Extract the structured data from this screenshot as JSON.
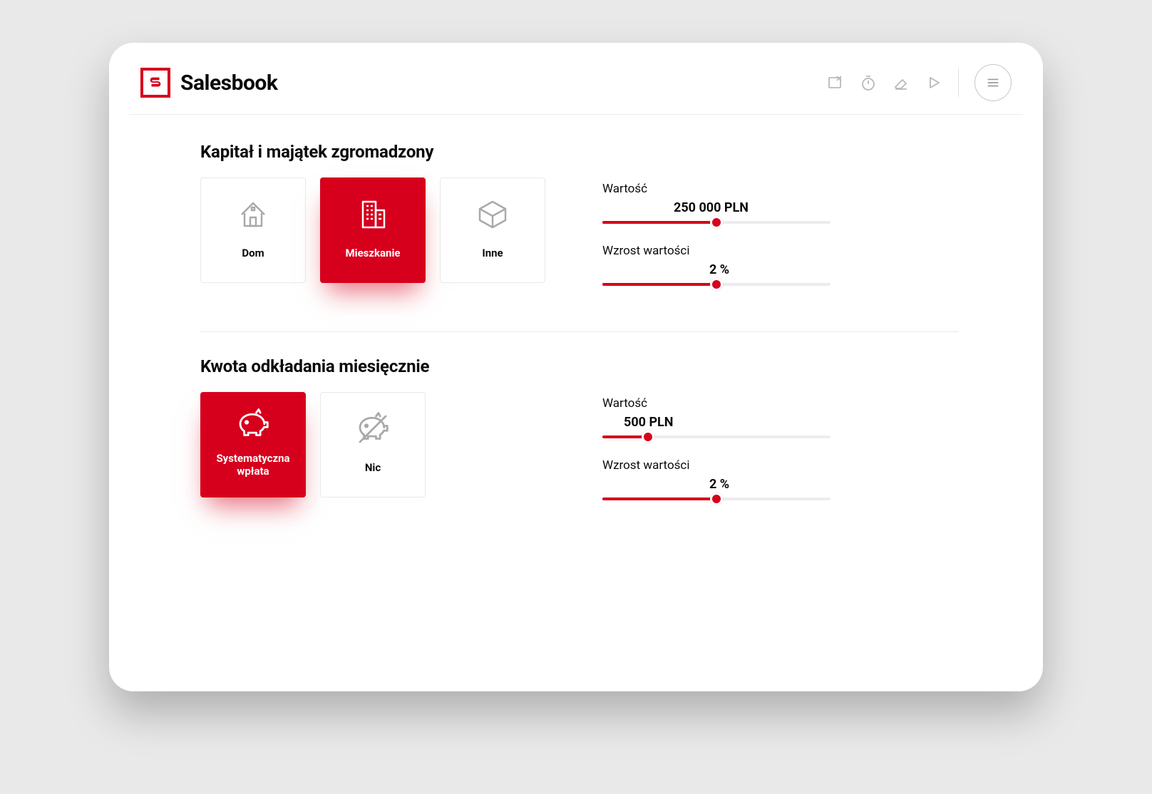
{
  "brand": {
    "name": "Salesbook"
  },
  "toolbar": {
    "icons": [
      "edit-icon",
      "timer-icon",
      "eraser-icon",
      "play-icon"
    ],
    "menu": "menu"
  },
  "section1": {
    "title": "Kapitał i majątek zgromadzony",
    "cards": [
      {
        "id": "dom",
        "label": "Dom",
        "icon": "house-icon",
        "active": false
      },
      {
        "id": "mieszkanie",
        "label": "Mieszkanie",
        "icon": "building-icon",
        "active": true
      },
      {
        "id": "inne",
        "label": "Inne",
        "icon": "cube-icon",
        "active": false
      }
    ],
    "slider_value": {
      "label": "Wartość",
      "display": "250 000 PLN",
      "percent": 50
    },
    "slider_growth": {
      "label": "Wzrost wartości",
      "display": "2 %",
      "percent": 50
    }
  },
  "section2": {
    "title": "Kwota odkładania miesięcznie",
    "cards": [
      {
        "id": "systematyczna",
        "label": "Systematyczna wpłata",
        "icon": "piggy-icon",
        "active": true
      },
      {
        "id": "nic",
        "label": "Nic",
        "icon": "piggy-slash-icon",
        "active": false
      }
    ],
    "slider_value": {
      "label": "Wartość",
      "display": "500 PLN",
      "percent": 20
    },
    "slider_growth": {
      "label": "Wzrost wartości",
      "display": "2 %",
      "percent": 50
    }
  }
}
